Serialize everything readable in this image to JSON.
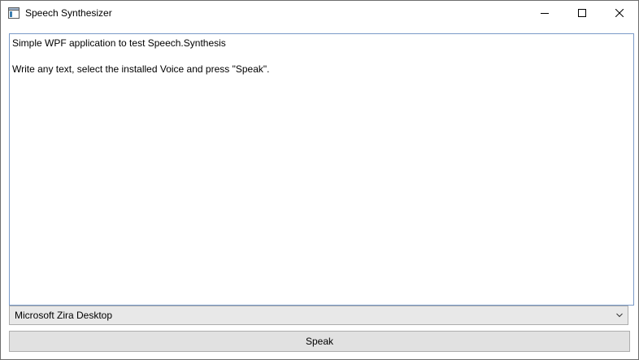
{
  "window": {
    "title": "Speech Synthesizer",
    "icon": "window-app-icon"
  },
  "caption_buttons": {
    "minimize_icon": "minimize-icon",
    "maximize_icon": "maximize-icon",
    "close_icon": "close-icon"
  },
  "editor": {
    "lines": [
      "Simple WPF application to test Speech.Synthesis",
      "",
      "Write any text, select the installed Voice and press \"Speak\"."
    ]
  },
  "voice_select": {
    "selected": "Microsoft Zira Desktop",
    "arrow_icon": "chevron-down-icon"
  },
  "speak_button": {
    "label": "Speak"
  },
  "colors": {
    "textbox_border": "#7a9ac8",
    "button_bg": "#e1e1e1",
    "combo_bg": "#e8e8e8"
  }
}
